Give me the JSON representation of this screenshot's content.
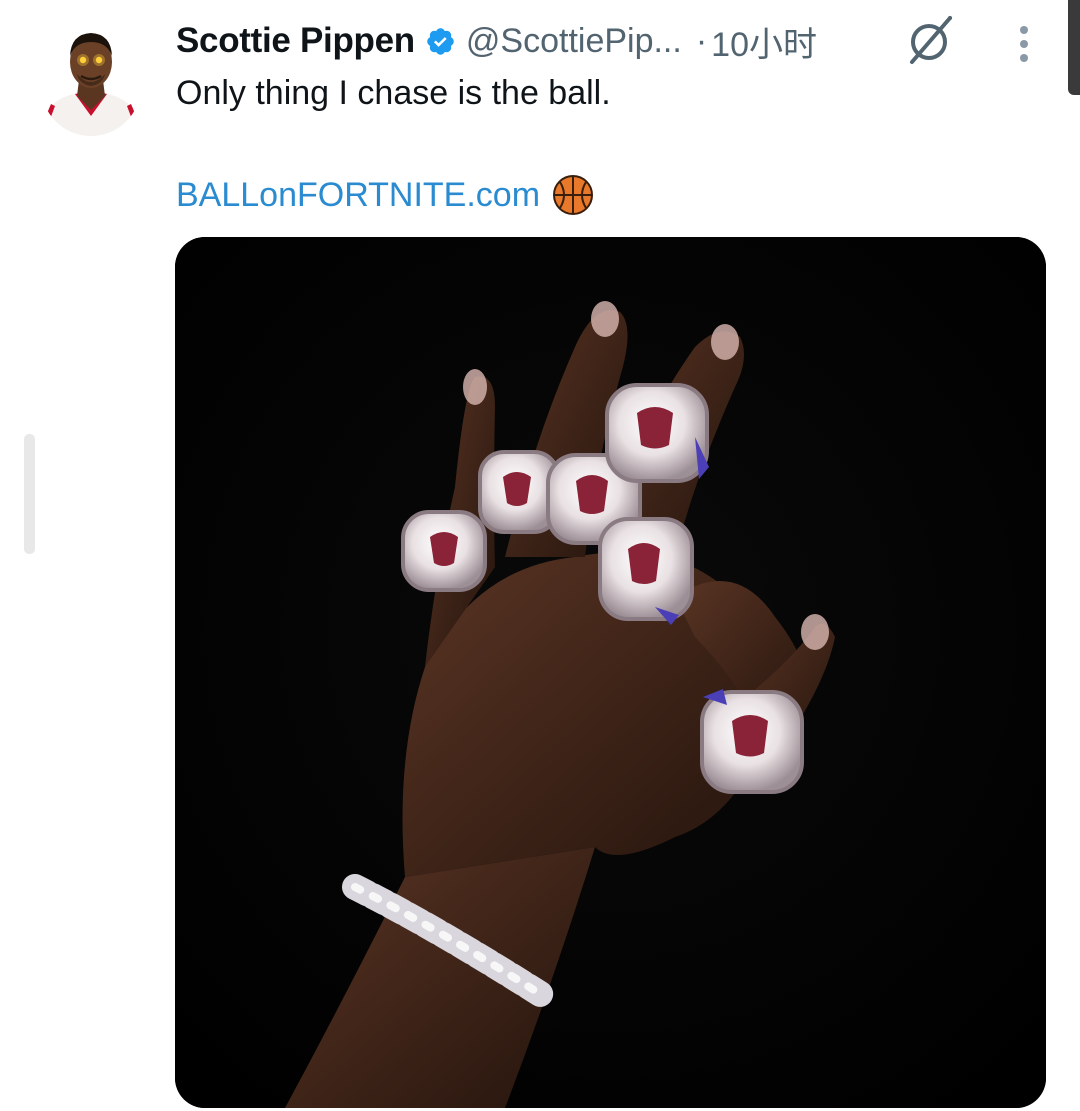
{
  "tweet": {
    "author": {
      "display_name": "Scottie Pippen",
      "handle": "@ScottiePip...",
      "verified": true,
      "avatar_icon": "avatar-photo"
    },
    "separator": "·",
    "time": "10小时",
    "text": "Only thing I chase is the ball.",
    "link": "BALLonFORTNITE.com",
    "link_emoji": "basketball-icon",
    "media_icon": "championship-rings-photo"
  },
  "colors": {
    "link": "#2a8bd1",
    "verified": "#1d9bf0",
    "secondary_text": "#536471",
    "primary_text": "#0f1419"
  }
}
